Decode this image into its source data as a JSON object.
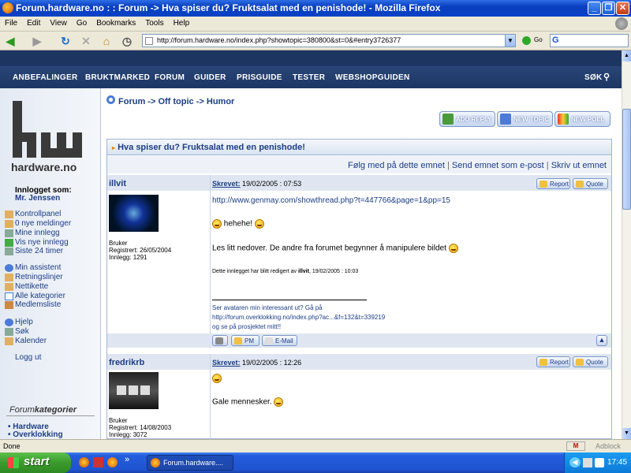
{
  "window": {
    "title": "Forum.hardware.no : : Forum -> Hva spiser du? Fruktsalat med en penishode! - Mozilla Firefox",
    "btn_min": "_",
    "btn_max": "❐",
    "btn_close": "✕"
  },
  "menu": [
    "File",
    "Edit",
    "View",
    "Go",
    "Bookmarks",
    "Tools",
    "Help"
  ],
  "browser": {
    "url": "http://forum.hardware.no/index.php?showtopic=380800&st=0&#entry3726377",
    "go_label": "Go",
    "search_value": "G"
  },
  "site": {
    "nav": [
      "ANBEFALINGER",
      "BRUKTMARKED",
      "FORUM",
      "GUIDER",
      "PRISGUIDE",
      "TESTER",
      "WEBSHOPGUIDEN"
    ],
    "search_label": "SØK",
    "logo_text": "hardware.no"
  },
  "sidebar": {
    "logged_in_label": "Innlogget som:",
    "user": "Mr. Jenssen",
    "group1": [
      "Kontrollpanel",
      "0 nye meldinger",
      "Mine innlegg",
      "Vis nye innlegg",
      "Siste 24 timer"
    ],
    "group2": [
      "Min assistent",
      "Retningslinjer",
      "Nettikette",
      "Alle kategorier",
      "Medlemsliste"
    ],
    "group3": [
      "Hjelp",
      "Søk",
      "Kalender"
    ],
    "logout": "Logg ut",
    "categories_title_1": "Forum",
    "categories_title_2": "kategorier",
    "categories": [
      "Hardware",
      "Overklokking"
    ]
  },
  "breadcrumb": {
    "forum": "Forum",
    "sep1": "->",
    "offtopic": "Off topic",
    "sep2": "->",
    "humor": "Humor"
  },
  "actions": {
    "reply": "ADD REPLY",
    "new_topic": "NEW TOPIC",
    "new_poll": "NEW POLL"
  },
  "topic": {
    "title": "Hva spiser du? Fruktsalat med en penishode!",
    "follow": "Følg med på dette emnet",
    "send": "Send emnet som e-post",
    "print": "Skriv ut emnet",
    "sep": "|"
  },
  "posts": [
    {
      "author": "illvit",
      "written_label": "Skrevet:",
      "date": "19/02/2005 : 07:53",
      "report": "Report",
      "quote": "Quote",
      "role": "Bruker",
      "registered": "Registrert: 26/05/2004",
      "posts": "Innlegg: 1291",
      "link": "http://www.genmay.com/showthread.php?t=447766&page=1&pp=15",
      "line1": "hehehe!",
      "line2": "Les litt nedover. De andre fra forumet begynner å manipulere bildet",
      "edited_prefix": "Dette innlegget har blitt redigert av ",
      "edited_by": "illvit",
      "edited_suffix": ", 19/02/2005 : 10:03",
      "sig1": "Ser avataren min interessant ut? Gå på",
      "sig2": "http://forum.overklokking.no/index.php?ac...&f=132&t=339219",
      "sig3": "og se på prosjektet mitt!!",
      "pm": "PM",
      "email": "E-Mail"
    },
    {
      "author": "fredrikrb",
      "written_label": "Skrevet:",
      "date": "19/02/2005 : 12:26",
      "report": "Report",
      "quote": "Quote",
      "role": "Bruker",
      "registered": "Registrert: 14/08/2003",
      "posts": "Innlegg: 3072",
      "line1": "Gale mennesker."
    }
  ],
  "status": {
    "text": "Done",
    "adblock": "Adblock"
  },
  "taskbar": {
    "start": "start",
    "task": "Forum.hardware....",
    "more": "»",
    "clock": "17:45"
  }
}
